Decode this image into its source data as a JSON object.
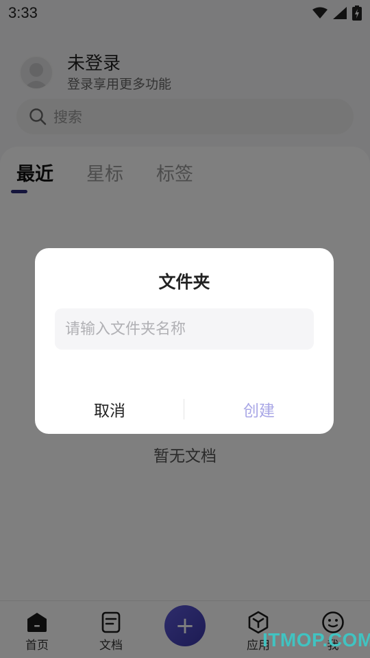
{
  "status_bar": {
    "time": "3:33",
    "icons": [
      "wifi-icon",
      "signal-icon",
      "battery-charging-icon"
    ]
  },
  "profile": {
    "name": "未登录",
    "subtitle": "登录享用更多功能"
  },
  "search": {
    "label": "搜索"
  },
  "tabs": [
    {
      "label": "最近",
      "active": true
    },
    {
      "label": "星标",
      "active": false
    },
    {
      "label": "标签",
      "active": false
    }
  ],
  "empty_state": {
    "text": "暂无文档"
  },
  "bottom_nav": [
    {
      "label": "首页",
      "icon": "home-icon"
    },
    {
      "label": "文档",
      "icon": "document-icon"
    },
    {
      "label": "",
      "icon": "plus-icon"
    },
    {
      "label": "应用",
      "icon": "cube-icon"
    },
    {
      "label": "我",
      "icon": "smile-icon"
    }
  ],
  "dialog": {
    "title": "文件夹",
    "input_placeholder": "请输入文件夹名称",
    "input_value": "",
    "cancel_label": "取消",
    "confirm_label": "创建"
  },
  "watermark": {
    "text": "ITMOP.COM"
  },
  "colors": {
    "accent": "#2b2a78",
    "fab": "#4a47c2",
    "confirm_disabled": "#a9a7e6",
    "watermark": "#41c3c1"
  }
}
